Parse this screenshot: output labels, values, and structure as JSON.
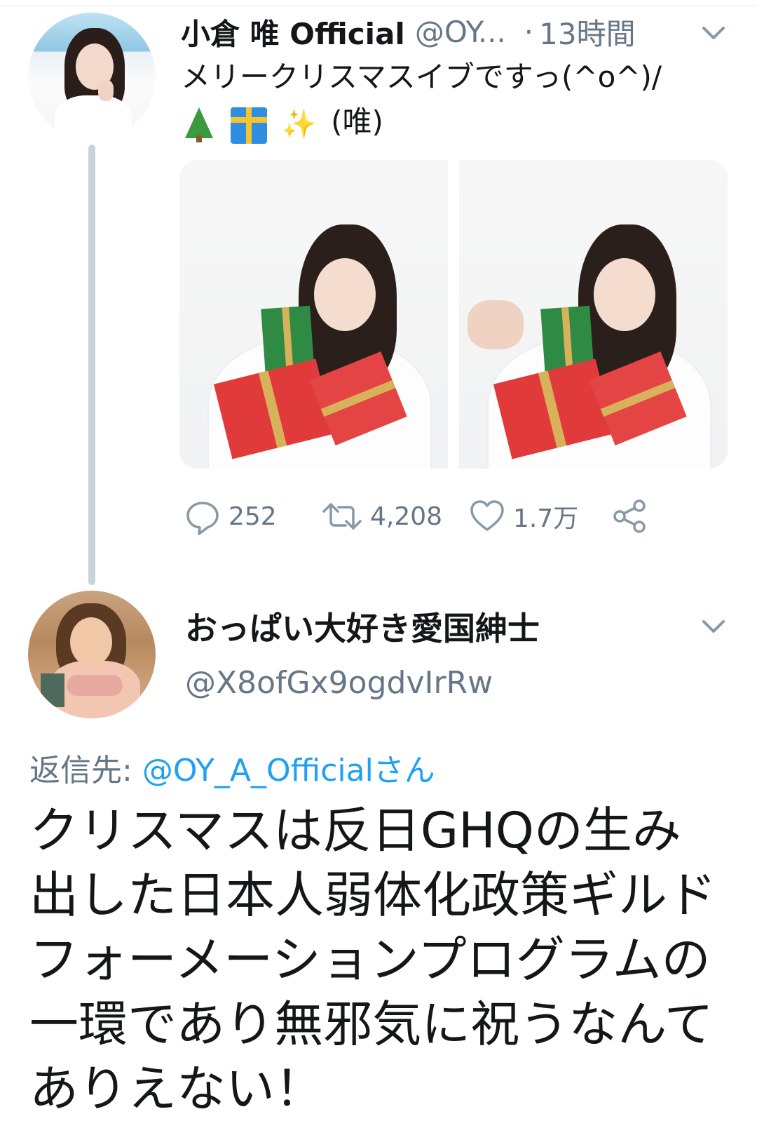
{
  "tweet": {
    "display_name": "小倉 唯 Official",
    "handle": "@OY...",
    "separator": "·",
    "time": "13時間",
    "text_line1": "メリークリスマスイブですっ(^o^)/",
    "text_line2_suffix": "(唯)",
    "emojis": [
      "christmas-tree",
      "wrapped-gift",
      "sparkles"
    ],
    "sparkle_glyph": "✨",
    "actions": {
      "replies": "252",
      "retweets": "4,208",
      "likes": "1.7万"
    }
  },
  "reply": {
    "display_name": "おっぱい大好き愛国紳士",
    "handle": "@X8ofGx9ogdvIrRw",
    "replying_to_label": "返信先:",
    "replying_to_mention": "@OY_A_Officialさん",
    "text": "クリスマスは反日GHQの生み出した日本人弱体化政策ギルドフォーメーションプログラムの一環であり無邪気に祝うなんてありえない！"
  },
  "colors": {
    "accent": "#1da1f2",
    "secondary_text": "#657786",
    "primary_text": "#14171a",
    "thread_line": "#c8d4dc"
  }
}
